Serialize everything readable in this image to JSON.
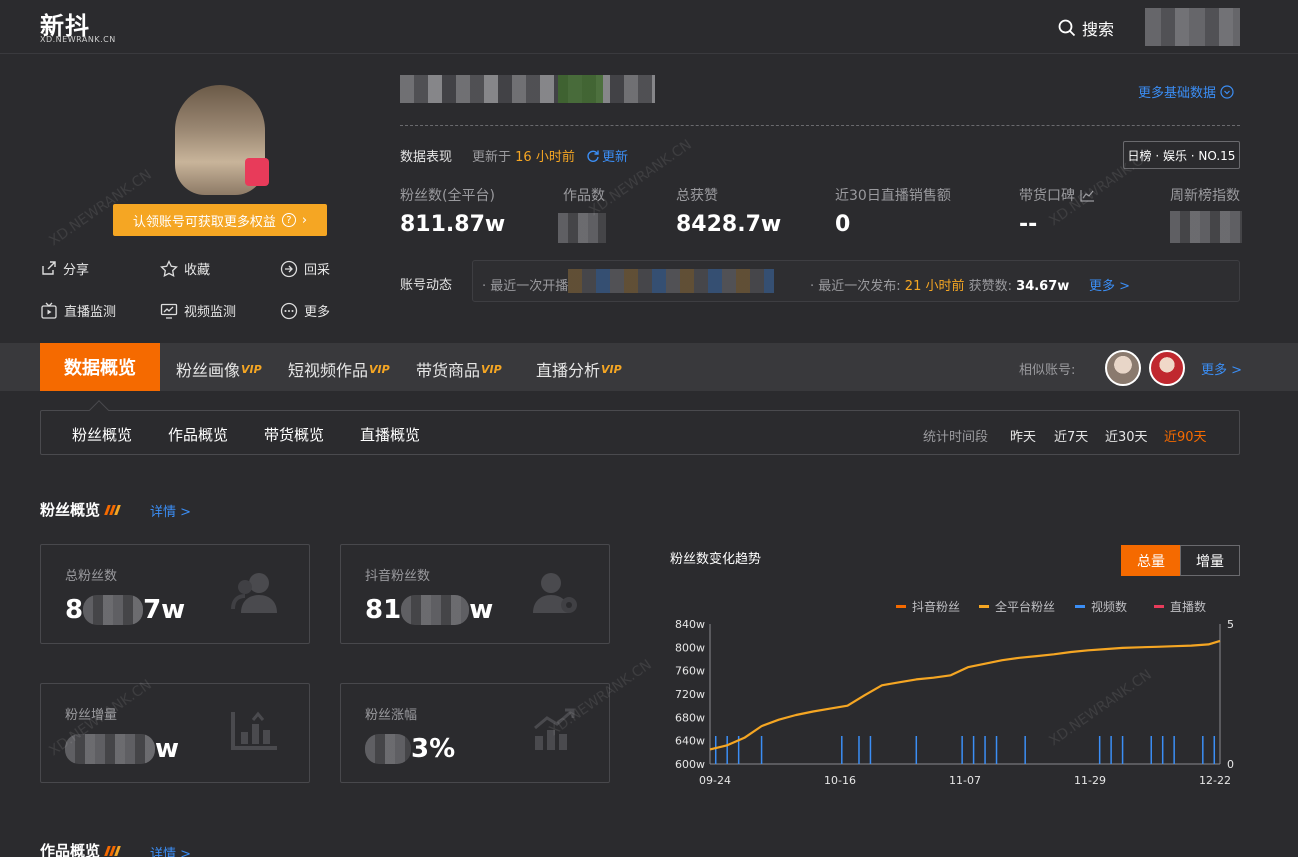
{
  "header": {
    "logo": "新抖",
    "logo_sub": "XD.NEWRANK.CN",
    "search_label": "搜索"
  },
  "profile": {
    "claim_button": "认领账号可获取更多权益",
    "actions": [
      {
        "label": "分享",
        "icon": "share-icon"
      },
      {
        "label": "收藏",
        "icon": "star-icon"
      },
      {
        "label": "回采",
        "icon": "recollect-icon"
      },
      {
        "label": "直播监测",
        "icon": "live-monitor-icon"
      },
      {
        "label": "视频监测",
        "icon": "video-monitor-icon"
      },
      {
        "label": "更多",
        "icon": "more-icon"
      }
    ],
    "more_basic": "更多基础数据"
  },
  "performance": {
    "title": "数据表现",
    "updated_prefix": "更新于",
    "updated_time": "16 小时前",
    "refresh": "更新",
    "rank_badge": "日榜 · 娱乐 · NO.15",
    "stats": [
      {
        "label": "粉丝数(全平台)",
        "value": "811.87w"
      },
      {
        "label": "作品数",
        "value": ""
      },
      {
        "label": "总获赞",
        "value": "8428.7w"
      },
      {
        "label": "近30日直播销售额",
        "value": "0"
      },
      {
        "label": "带货口碑",
        "value": "--"
      },
      {
        "label": "周新榜指数",
        "value": ""
      }
    ]
  },
  "dynamics": {
    "label": "账号动态",
    "live_prefix": "· 最近一次开播",
    "publish_prefix": "· 最近一次发布:",
    "publish_time": "21 小时前",
    "likes_label": "获赞数:",
    "likes_value": "34.67w",
    "more": "更多 >"
  },
  "tabs": {
    "active": "数据概览",
    "items": [
      {
        "label": "粉丝画像",
        "vip": "VIP"
      },
      {
        "label": "短视频作品",
        "vip": "VIP"
      },
      {
        "label": "带货商品",
        "vip": "VIP"
      },
      {
        "label": "直播分析",
        "vip": "VIP"
      }
    ],
    "similar_label": "相似账号:",
    "similar_more": "更多 >"
  },
  "subtabs": {
    "items": [
      "粉丝概览",
      "作品概览",
      "带货概览",
      "直播概览"
    ],
    "period_label": "统计时间段",
    "periods": [
      "昨天",
      "近7天",
      "近30天",
      "近90天"
    ],
    "active_period": "近90天"
  },
  "fans_overview": {
    "title": "粉丝概览",
    "detail": "详情 >",
    "cards": [
      {
        "label": "总粉丝数",
        "value_a": "8",
        "value_b": "7w"
      },
      {
        "label": "抖音粉丝数",
        "value_a": "81",
        "value_b": "w"
      },
      {
        "label": "粉丝增量",
        "value_a": "",
        "value_b": "w"
      },
      {
        "label": "粉丝涨幅",
        "value_a": "",
        "value_b": "3%"
      }
    ]
  },
  "works_overview": {
    "title": "作品概览",
    "detail": "详情 >"
  },
  "chart_data": {
    "type": "line",
    "title": "粉丝数变化趋势",
    "toggle": [
      "总量",
      "增量"
    ],
    "active_toggle": "总量",
    "legend": [
      "抖音粉丝",
      "全平台粉丝",
      "视频数",
      "直播数"
    ],
    "colors": {
      "douyin": "#f56a00",
      "all": "#f5a623",
      "video": "#3b8ef5",
      "live": "#e83b5a"
    },
    "x_ticks": [
      "09-24",
      "10-16",
      "11-07",
      "11-29",
      "12-22"
    ],
    "y_ticks": [
      "600w",
      "640w",
      "680w",
      "720w",
      "760w",
      "800w",
      "840w"
    ],
    "y2_ticks": [
      "0",
      "5"
    ],
    "ylim": [
      600,
      840
    ],
    "y2lim": [
      0,
      5
    ],
    "x_range_days": 89,
    "series": [
      {
        "name": "全平台粉丝",
        "x": [
          0,
          3,
          6,
          9,
          12,
          15,
          18,
          21,
          24,
          27,
          30,
          33,
          36,
          39,
          42,
          45,
          48,
          51,
          54,
          57,
          60,
          63,
          66,
          69,
          72,
          75,
          78,
          81,
          84,
          87,
          89
        ],
        "values": [
          625,
          632,
          645,
          665,
          676,
          684,
          690,
          695,
          700,
          718,
          735,
          740,
          745,
          748,
          752,
          766,
          772,
          778,
          782,
          785,
          788,
          792,
          795,
          797,
          799,
          800,
          801,
          802,
          803,
          805,
          811
        ]
      }
    ],
    "video_days": [
      1,
      3,
      5,
      9,
      23,
      26,
      28,
      36,
      44,
      46,
      48,
      50,
      55,
      68,
      70,
      72,
      77,
      79,
      81,
      86,
      88
    ],
    "video_values": [
      1,
      1,
      1,
      1,
      1,
      1,
      1,
      1,
      1,
      1,
      1,
      1,
      1,
      1,
      1,
      1,
      1,
      1,
      1,
      1,
      1
    ]
  }
}
